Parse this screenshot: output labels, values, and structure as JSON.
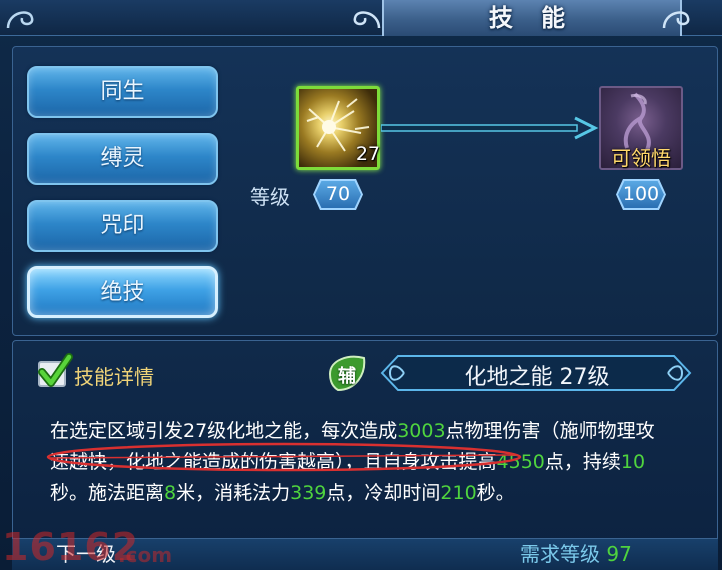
{
  "window": {
    "title": "技 能"
  },
  "tabs": [
    {
      "label": "同生",
      "active": false
    },
    {
      "label": "缚灵",
      "active": false
    },
    {
      "label": "咒印",
      "active": false
    },
    {
      "label": "绝技",
      "active": true
    }
  ],
  "skill_upgrade": {
    "current_icon": "golden-burst-icon",
    "current_level": "27",
    "level_label": "等级",
    "current_required_level": "70",
    "next_icon": "shadow-figure-icon",
    "next_status": "可领悟",
    "next_required_level": "100"
  },
  "details": {
    "checkbox_label": "技能详情",
    "checked": true,
    "type_badge": "辅",
    "skill_name": "化地之能 27级",
    "description": {
      "p1": "在选定区域引发27级化地之能，每次造成",
      "damage": "3003",
      "p2": "点物理伤害（",
      "p3": "施师物理攻速越快，化地之能造成的伤害越高）",
      "p4": "，且自身攻击提高",
      "attack_bonus": "4550",
      "p5": "点，持续",
      "duration": "10",
      "p6": "秒。施法距离",
      "range": "8",
      "p7": "米，消耗法力",
      "mana": "339",
      "p8": "点，冷却时间",
      "cooldown": "210",
      "p9": "秒。"
    }
  },
  "footer": {
    "next_level_label": "下一级",
    "required_level_label": "需求等级",
    "required_level_value": "97"
  },
  "watermark": {
    "text": "16162",
    "suffix": ".com"
  },
  "colors": {
    "highlight_number": "#4fd43e",
    "accent_gold": "#f0d478",
    "panel": "#0f2846"
  }
}
